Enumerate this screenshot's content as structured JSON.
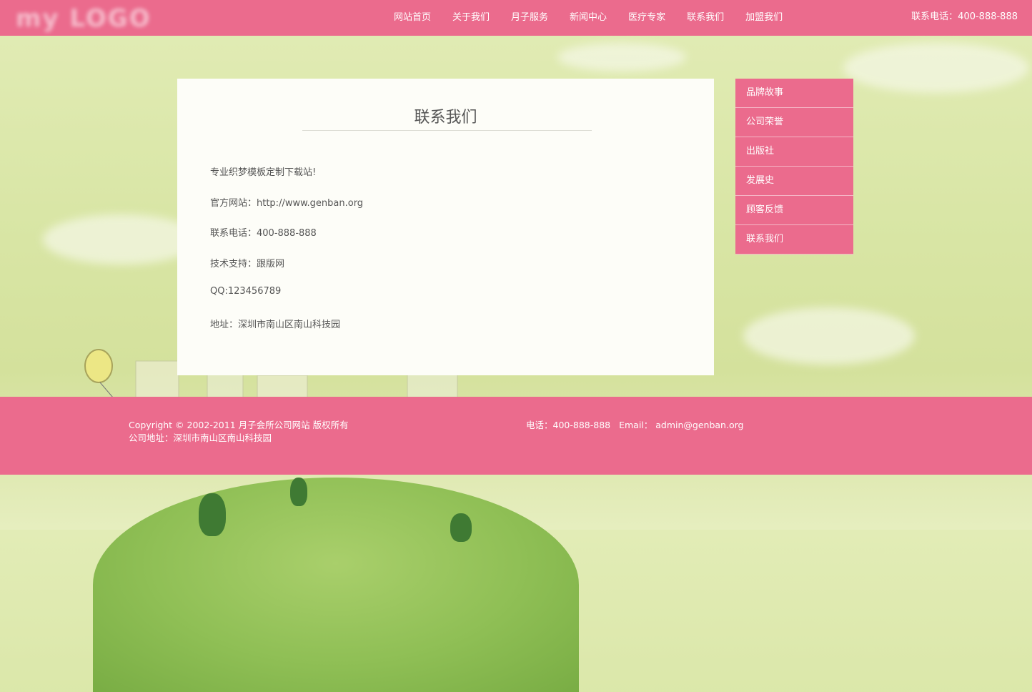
{
  "header": {
    "logo_text": "my LOGO",
    "nav": [
      "网站首页",
      "关于我们",
      "月子服务",
      "新闻中心",
      "医疗专家",
      "联系我们",
      "加盟我们"
    ],
    "phone": "联系电话：400-888-888"
  },
  "content": {
    "title": "联系我们",
    "lines": [
      "专业织梦模板定制下载站!",
      "官方网站：http://www.genban.org",
      "联系电话：400-888-888",
      "技术支持：跟版网",
      "QQ:123456789",
      "地址：深圳市南山区南山科技园"
    ]
  },
  "side_menu": [
    "品牌故事",
    "公司荣誉",
    "出版社",
    "发展史",
    "顾客反馈",
    "联系我们"
  ],
  "footer": {
    "copyright": "Copyright © 2002-2011 月子会所公司网站 版权所有",
    "address": "公司地址：深圳市南山区南山科技园",
    "phone": "电话：400-888-888",
    "email": "Email： admin@genban.org"
  },
  "colors": {
    "brand_pink": "#eb6b8d",
    "background_green": "#d9e6a6",
    "content_bg": "#fdfdf8"
  }
}
